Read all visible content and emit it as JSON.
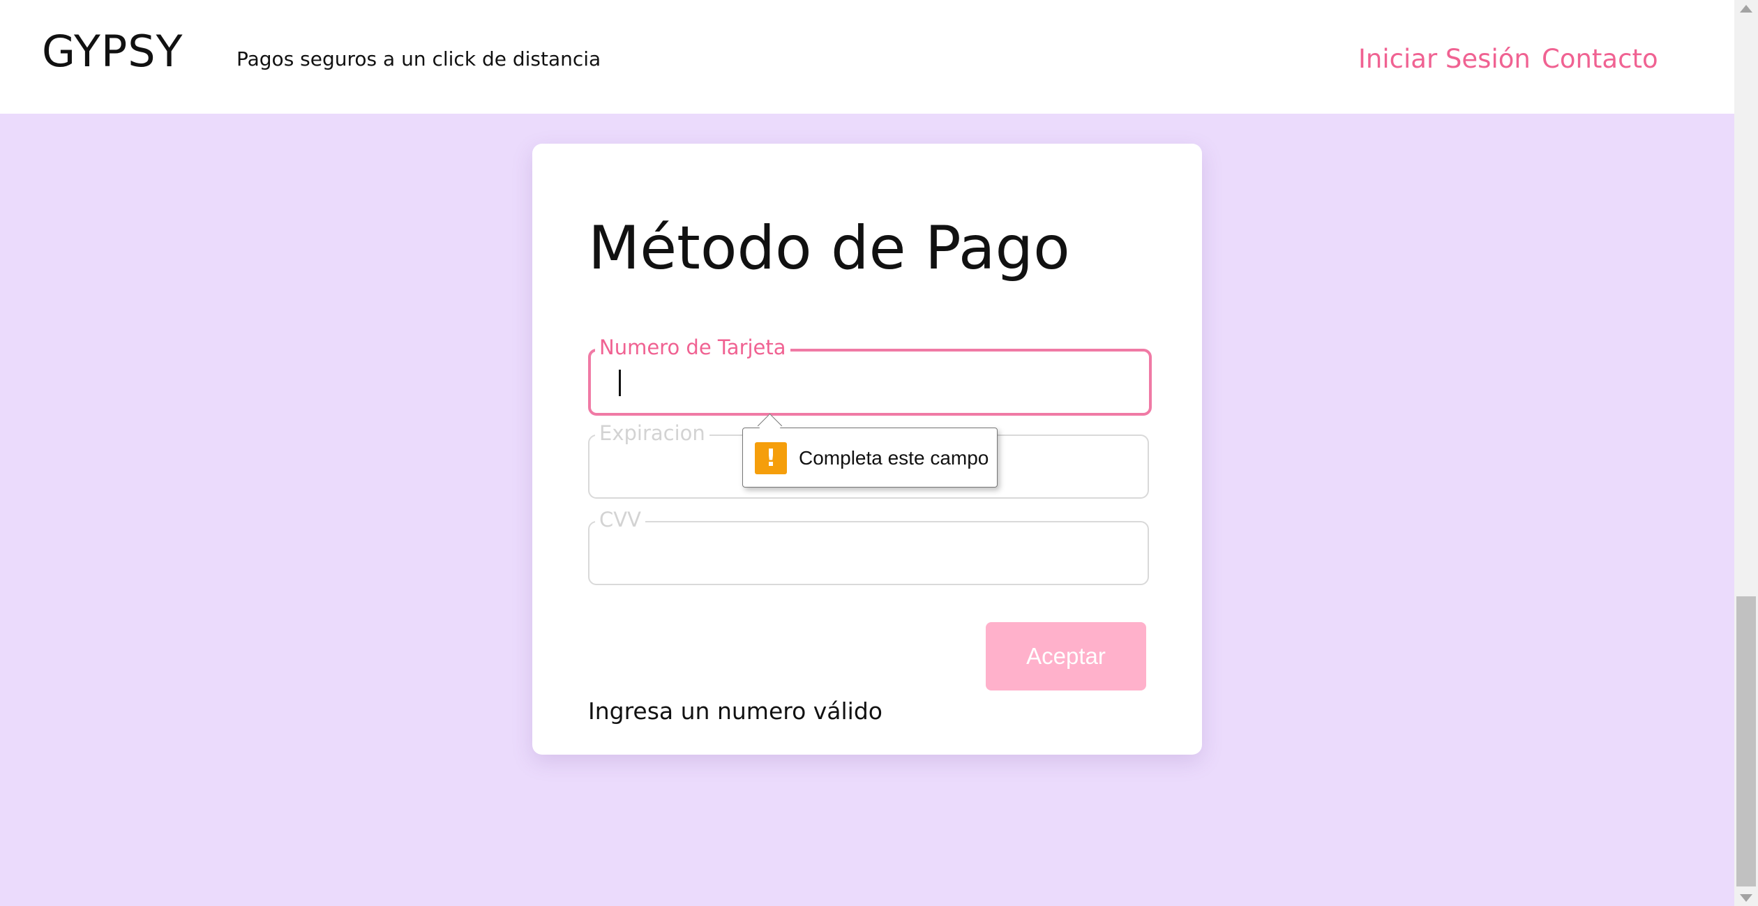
{
  "header": {
    "brand": "GYPSY",
    "tagline": "Pagos seguros a un click de distancia",
    "nav": {
      "login": "Iniciar Sesión",
      "contact": "Contacto"
    },
    "accent_color": "#f06292"
  },
  "form": {
    "title": "Método de Pago",
    "fields": {
      "card_number": {
        "label": "Numero de Tarjeta",
        "value": ""
      },
      "expiration": {
        "label": "Expiracion",
        "value": ""
      },
      "cvv": {
        "label": "CVV",
        "value": ""
      }
    },
    "submit_label": "Aceptar",
    "error_message": "Ingresa un numero válido"
  },
  "validation_tooltip": {
    "icon": "warning-icon",
    "text": "Completa este campo",
    "icon_color": "#f59e0b"
  },
  "page": {
    "background_color": "#ebdbfc"
  }
}
